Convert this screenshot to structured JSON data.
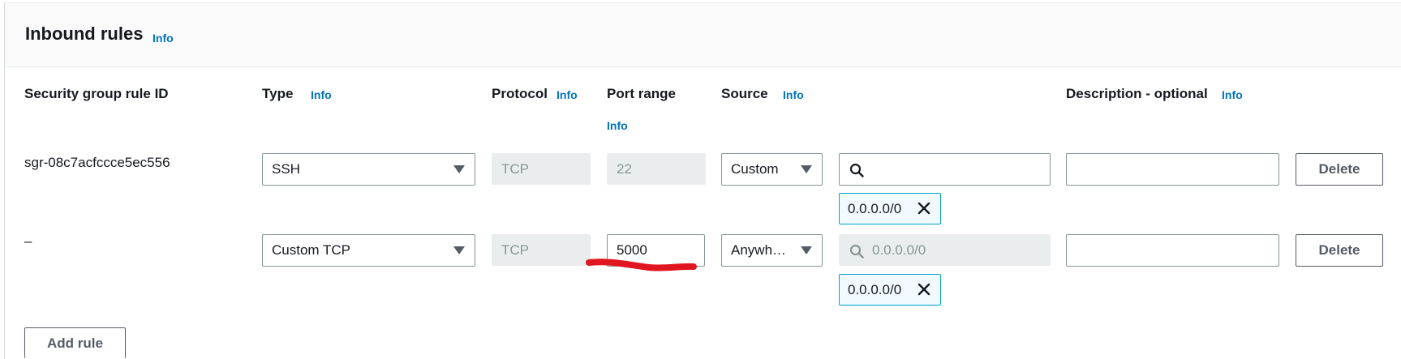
{
  "section": {
    "title": "Inbound rules",
    "info_label": "Info"
  },
  "columns": {
    "rule_id": "Security group rule ID",
    "type": "Type",
    "protocol": "Protocol",
    "port_range": "Port range",
    "source": "Source",
    "description": "Description - optional",
    "info_label": "Info"
  },
  "rules": [
    {
      "rule_id": "sgr-08c7acfccce5ec556",
      "type": "SSH",
      "protocol": "TCP",
      "port_range": "22",
      "source": "Custom",
      "source_search_value": "",
      "source_search_placeholder": "",
      "cidr_token": "0.0.0.0/0",
      "description": "",
      "delete_label": "Delete"
    },
    {
      "rule_id": "–",
      "type": "Custom TCP",
      "protocol": "TCP",
      "port_range": "5000",
      "source": "Anywh…",
      "source_search_value": "",
      "source_search_placeholder": "0.0.0.0/0",
      "cidr_token": "0.0.0.0/0",
      "description": "",
      "delete_label": "Delete"
    }
  ],
  "add_rule_label": "Add rule",
  "colors": {
    "info_link": "#0073bb",
    "token_border": "#00a1c9",
    "annotation_red": "#e0151f"
  }
}
